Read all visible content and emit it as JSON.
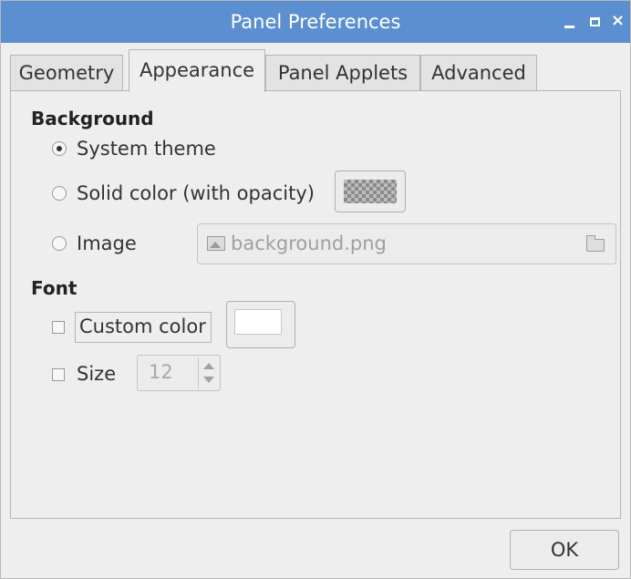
{
  "window": {
    "title": "Panel Preferences",
    "minimize": "_",
    "close": "×",
    "titlebar_color": "#5b8fcf"
  },
  "tabs": [
    {
      "label": "Geometry",
      "active": false
    },
    {
      "label": "Appearance",
      "active": true
    },
    {
      "label": "Panel Applets",
      "active": false
    },
    {
      "label": "Advanced",
      "active": false
    }
  ],
  "background": {
    "heading": "Background",
    "options": [
      {
        "label": "System theme",
        "selected": true
      },
      {
        "label": "Solid color (with opacity)",
        "selected": false
      },
      {
        "label": "Image",
        "selected": false
      }
    ],
    "image_file": "background.png"
  },
  "font": {
    "heading": "Font",
    "custom_color_label": "Custom color",
    "custom_color_checked": false,
    "size_label": "Size",
    "size_checked": false,
    "size_value": "12"
  },
  "buttons": {
    "ok": "OK"
  }
}
